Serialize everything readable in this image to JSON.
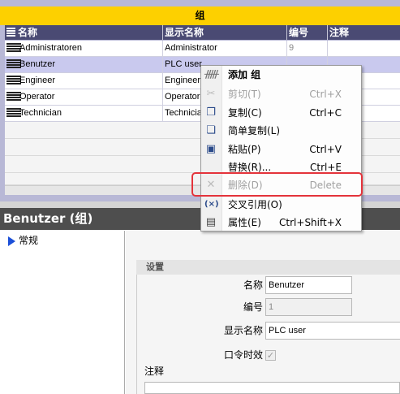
{
  "table": {
    "group_title": "组",
    "columns": [
      "名称",
      "显示名称",
      "编号",
      "注释"
    ],
    "rows": [
      {
        "name": "Administratoren",
        "display": "Administrator",
        "number": "9",
        "comment": ""
      },
      {
        "name": "Benutzer",
        "display": "PLC user",
        "number": "",
        "comment": ""
      },
      {
        "name": "Engineer",
        "display": "Engineer",
        "number": "",
        "comment": ""
      },
      {
        "name": "Operator",
        "display": "Operator",
        "number": "",
        "comment": ""
      },
      {
        "name": "Technician",
        "display": "Technicia",
        "number": "",
        "comment": ""
      }
    ]
  },
  "context_menu": {
    "items": [
      {
        "label": "添加 组",
        "shortcut": "",
        "icon": "add-group-icon",
        "disabled": false
      },
      {
        "label": "剪切(T)",
        "shortcut": "Ctrl+X",
        "icon": "scissors-icon",
        "disabled": true
      },
      {
        "label": "复制(C)",
        "shortcut": "Ctrl+C",
        "icon": "copy-icon",
        "disabled": false
      },
      {
        "label": "简单复制(L)",
        "shortcut": "",
        "icon": "simple-copy-icon",
        "disabled": false
      },
      {
        "label": "粘贴(P)",
        "shortcut": "Ctrl+V",
        "icon": "paste-icon",
        "disabled": false
      },
      {
        "label": "替换(R)...",
        "shortcut": "Ctrl+E",
        "icon": "",
        "disabled": false
      },
      {
        "label": "删除(D)",
        "shortcut": "Delete",
        "icon": "delete-icon",
        "disabled": true
      },
      {
        "label": "交叉引用(O)",
        "shortcut": "",
        "icon": "cross-reference-icon",
        "disabled": false
      },
      {
        "label": "属性(E)",
        "shortcut": "Ctrl+Shift+X",
        "icon": "properties-icon",
        "disabled": false
      }
    ]
  },
  "panel": {
    "title": "Benutzer (组)",
    "tree_item": "常规",
    "section": "设置",
    "fields": {
      "name_label": "名称",
      "name_value": "Benutzer",
      "number_label": "编号",
      "number_value": "1",
      "display_label": "显示名称",
      "display_value": "PLC user",
      "password_expiry_label": "口令时效",
      "password_expiry_checked": true,
      "comment_label": "注释"
    }
  },
  "colors": {
    "header_yellow": "#fdd000",
    "column_header": "#4a4a73",
    "highlight_red": "#e4333b"
  }
}
